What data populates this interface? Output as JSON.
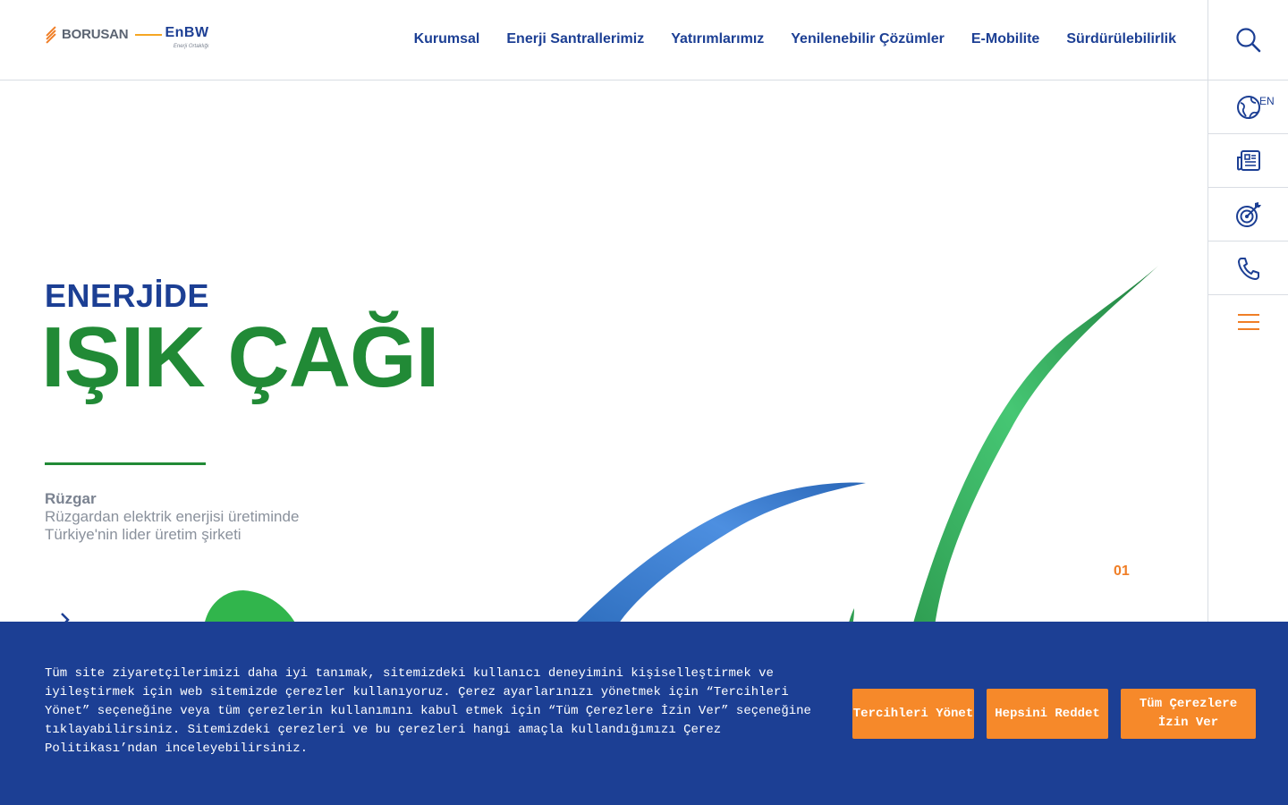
{
  "brand": {
    "logo_left": "BORUSAN",
    "logo_right": "EnBW",
    "logo_sub": "Enerji Ortaklığı"
  },
  "nav": {
    "items": [
      {
        "label": "Kurumsal"
      },
      {
        "label": "Enerji Santrallerimiz"
      },
      {
        "label": "Yatırımlarımız"
      },
      {
        "label": "Yenilenebilir Çözümler"
      },
      {
        "label": "E-Mobilite"
      },
      {
        "label": "Sürdürülebilirlik"
      }
    ]
  },
  "rail": {
    "lang_label": "EN",
    "icons": [
      "search-icon",
      "globe-icon",
      "news-icon",
      "target-icon",
      "phone-icon",
      "menu-icon"
    ]
  },
  "hero": {
    "kicker": "ENERJİDE",
    "title": "IŞIK ÇAĞI",
    "category": "Rüzgar",
    "description": "Rüzgardan elektrik enerjisi üretiminde Türkiye'nin lider üretim şirketi",
    "slide_number": "01"
  },
  "cookie": {
    "text": "Tüm site ziyaretçilerimizi daha iyi tanımak, sitemizdeki kullanıcı deneyimini kişiselleştirmek ve iyileştirmek için web sitemizde çerezler kullanıyoruz. Çerez ayarlarınızı yönetmek için “Tercihleri Yönet” seçeneğine veya tüm çerezlerin kullanımını kabul etmek için “Tüm Çerezlere İzin Ver” seçeneğine tıklayabilirsiniz. Sitemizdeki çerezleri ve bu çerezleri hangi amaçla kullandığımızı Çerez Politikası’ndan inceleyebilirsiniz.",
    "manage_label": "Tercihleri Yönet",
    "reject_label": "Hepsini Reddet",
    "accept_label": "Tüm Çerezlere İzin Ver"
  },
  "colors": {
    "brand_blue": "#1c3f94",
    "brand_green": "#218a36",
    "accent_orange": "#f07e26",
    "button_orange": "#f6892a"
  }
}
